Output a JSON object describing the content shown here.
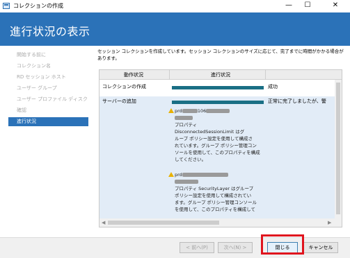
{
  "window": {
    "title": "コレクションの作成",
    "min_glyph": "—",
    "max_glyph": "☐",
    "close_glyph": "✕"
  },
  "header": {
    "title": "進行状況の表示"
  },
  "sidebar": {
    "items": [
      {
        "label": "開始する前に"
      },
      {
        "label": "コレクション名"
      },
      {
        "label": "RD セッション ホスト"
      },
      {
        "label": "ユーザー グループ"
      },
      {
        "label": "ユーザー プロファイル ディスク"
      },
      {
        "label": "確認"
      },
      {
        "label": "進行状況"
      }
    ]
  },
  "main": {
    "description": "セッション コレクションを作成しています。セッション コレクションのサイズに応じて、完了までに時間がかかる場合があります。",
    "table": {
      "columns": [
        "動作状況",
        "進行状況"
      ],
      "rows": [
        {
          "action": "コレクションの作成",
          "status": "成功",
          "progress": 1.0
        },
        {
          "action": "サーバーの追加",
          "status": "正常に完了しましたが、警",
          "progress": 1.0
        }
      ],
      "warnings": [
        {
          "server_prefix": "prd",
          "server_mid": "106",
          "lines": [
            "プロパティ",
            "DisconnectedSessionLimit はグ",
            "ループ ポリシー設定を使用して構成さ",
            "れています。グループ ポリシー管理コン",
            "ソールを使用して、このプロパティを構成",
            "してください。"
          ]
        },
        {
          "server_prefix": "prd",
          "lines": [
            "プロパティ SecurityLayer はグループ",
            "ポリシー設定を使用して構成されてい",
            "ます。グループ ポリシー管理コンソール",
            "を使用して、このプロパティを構成して"
          ]
        }
      ],
      "scroll_left": "◀",
      "scroll_right": "▶"
    }
  },
  "footer": {
    "prev": "< 前へ(P)",
    "next": "次へ(N) >",
    "close": "閉じる",
    "cancel": "キャンセル"
  },
  "colors": {
    "accent": "#2b72b8",
    "progress": "#1a6f85",
    "highlight": "#e0141e",
    "warning": "#e8b100"
  }
}
